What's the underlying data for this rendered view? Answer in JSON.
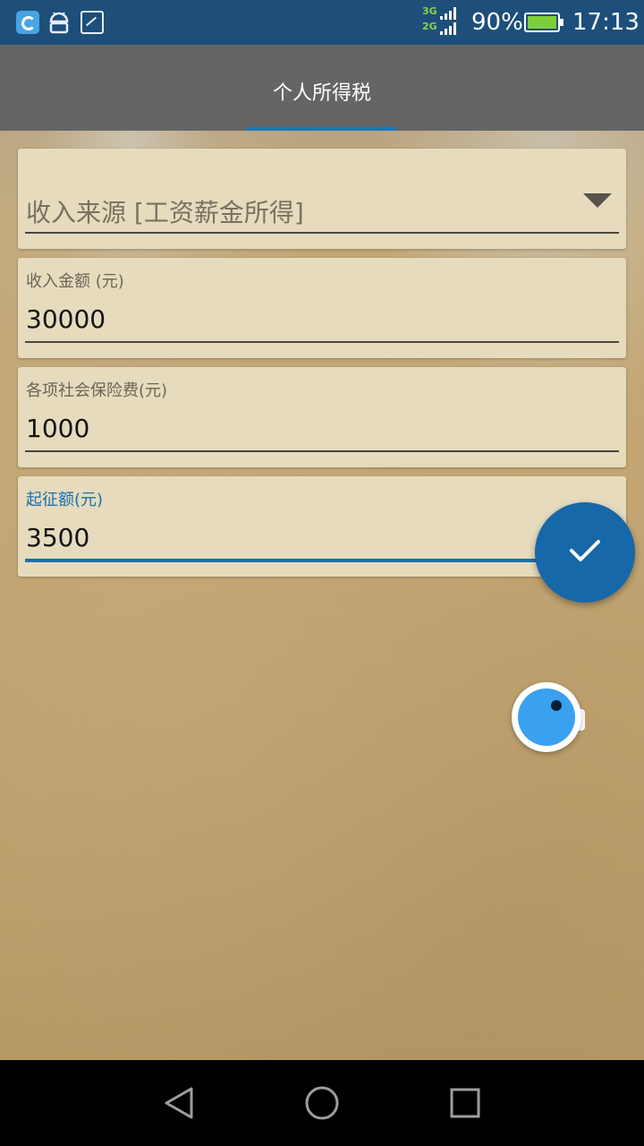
{
  "status_bar": {
    "icons": [
      "app-notification-icon",
      "android-debug-icon",
      "gallery-icon"
    ],
    "network_top": "3G",
    "network_bottom": "2G",
    "battery_percent": "90%",
    "time": "17:13"
  },
  "toolbar": {
    "tab_label": "个人所得税"
  },
  "form": {
    "income_source": "收入来源 [工资薪金所得]",
    "income_amount_label": "收入金额 (元)",
    "income_amount_value": "30000",
    "social_insurance_label": "各项社会保险费(元)",
    "social_insurance_value": "1000",
    "threshold_label": "起征额(元)",
    "threshold_value": "3500"
  },
  "colors": {
    "accent": "#1c6fae",
    "fab": "#1668a8",
    "card": "#e6dbbd",
    "status_bar": "#1d4f7a"
  }
}
